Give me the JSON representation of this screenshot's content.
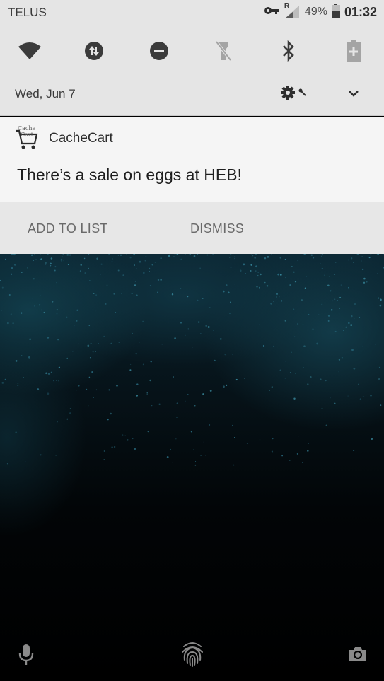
{
  "status_bar": {
    "carrier": "TELUS",
    "roaming_indicator": "R",
    "battery_percent": "49%",
    "time": "01:32",
    "icons": [
      "vpn-key-icon",
      "signal-icon",
      "battery-icon"
    ]
  },
  "quick_settings": {
    "tiles": [
      {
        "name": "wifi",
        "icon": "wifi-icon"
      },
      {
        "name": "data",
        "icon": "data-transfer-icon"
      },
      {
        "name": "do-not-disturb",
        "icon": "do-not-disturb-icon"
      },
      {
        "name": "flashlight",
        "icon": "flashlight-icon"
      },
      {
        "name": "bluetooth",
        "icon": "bluetooth-icon"
      },
      {
        "name": "battery-saver",
        "icon": "battery-saver-icon"
      }
    ],
    "date": "Wed, Jun 7"
  },
  "notification": {
    "app_icon_text": [
      "Cache",
      "Cart"
    ],
    "app_name": "CacheCart",
    "message": "There’s a sale on eggs at HEB!",
    "actions": [
      {
        "label": "ADD TO LIST"
      },
      {
        "label": "DISMISS"
      }
    ]
  },
  "lock_screen": {
    "bottom_icons": [
      "microphone-icon",
      "fingerprint-icon",
      "camera-icon"
    ]
  },
  "colors": {
    "shade_background": "#e5e5e5",
    "notification_background": "#f5f5f5",
    "actions_background": "#e7e7e7",
    "wallpaper_tint": "#0b2430"
  }
}
